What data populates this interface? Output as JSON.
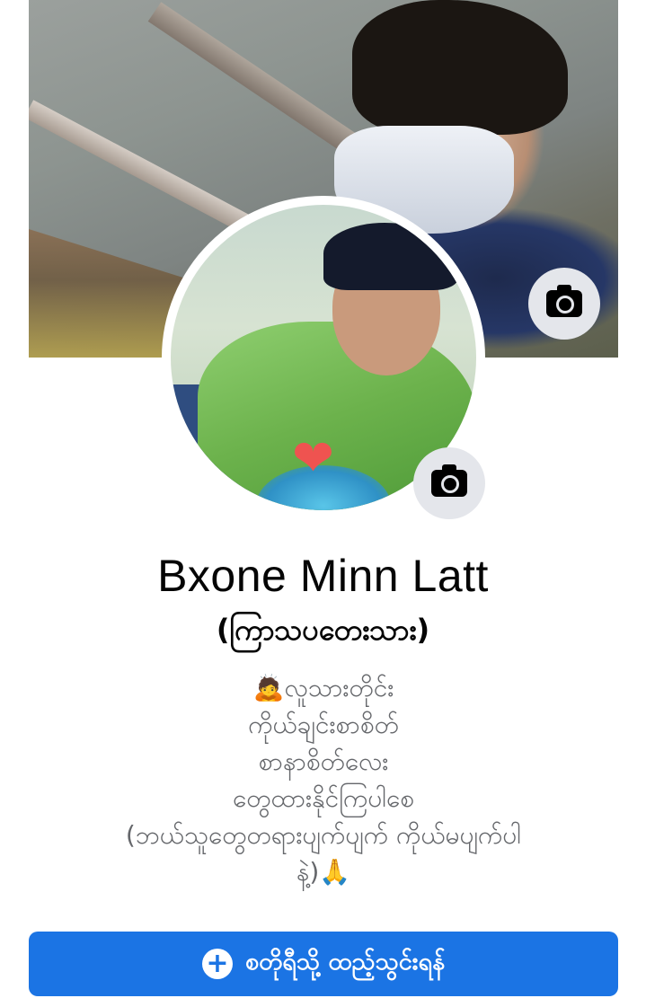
{
  "profile": {
    "name": "Bxone Minn Latt",
    "alternate_name": "(ကြာသပတေးသား)",
    "bio_lines": [
      "🙇လူသားတိုင်း",
      "ကိုယ်ချင်းစာစိတ်",
      "စာနာစိတ်လေး",
      "တွေထားနိုင်ကြပါစေ",
      "(ဘယ်သူတွေတရားပျက်ပျက် ကိုယ်မပျက်ပါ",
      "နဲ့)🙏"
    ]
  },
  "icons": {
    "cover_camera": "camera-icon",
    "avatar_camera": "camera-icon",
    "add_story": "plus-circle-icon"
  },
  "actions": {
    "add_to_story_label": "စတိုရီသို့ ထည့်သွင်းရန်",
    "add_to_story_plus": "+"
  },
  "colors": {
    "primary_button": "#1b74e4",
    "camera_button_bg": "#e4e6eb",
    "bio_text": "#65676b",
    "name_text": "#050505"
  }
}
